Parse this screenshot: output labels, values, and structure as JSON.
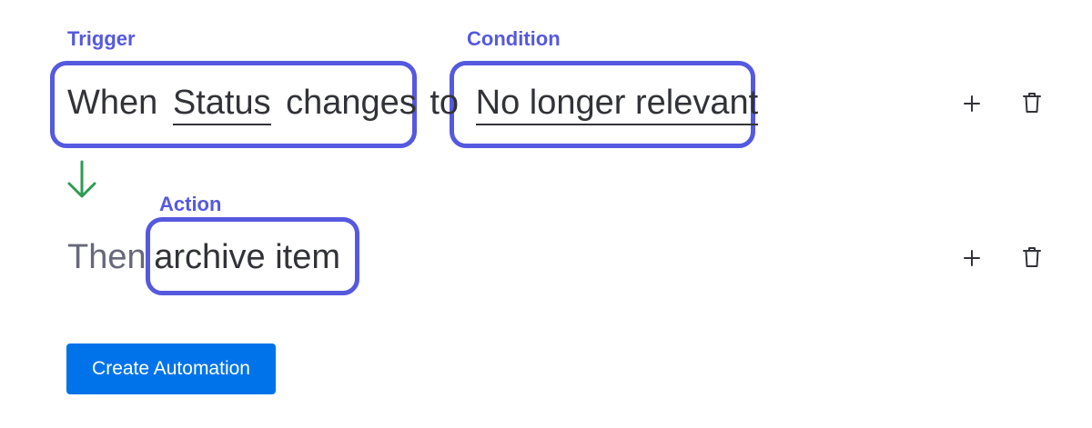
{
  "labels": {
    "trigger": "Trigger",
    "condition": "Condition",
    "action": "Action"
  },
  "trigger_row": {
    "when": "When",
    "column": "Status",
    "changes": "changes",
    "to": "to",
    "value": "No longer relevant"
  },
  "action_row": {
    "then": "Then",
    "action": "archive item"
  },
  "buttons": {
    "create": "Create Automation"
  },
  "icons": {
    "arrow": "arrow-down-icon",
    "add": "plus-icon",
    "delete": "trash-icon"
  },
  "colors": {
    "highlight": "#5559df",
    "arrow": "#2e9b54",
    "primary": "#0073ea"
  }
}
